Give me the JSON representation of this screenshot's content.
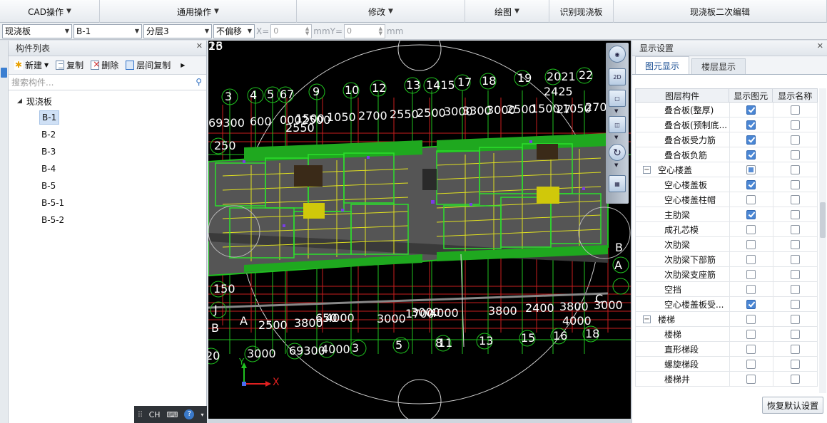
{
  "menubar": {
    "items": [
      {
        "label": "CAD操作",
        "caret": true
      },
      {
        "label": "通用操作",
        "caret": true
      },
      {
        "label": "修改",
        "caret": true
      },
      {
        "label": "绘图",
        "caret": true
      },
      {
        "label": "识别现浇板",
        "caret": false
      },
      {
        "label": "现浇板二次编辑",
        "caret": false
      }
    ]
  },
  "toolbar": {
    "type_select": "现浇板",
    "component_select": "B-1",
    "layer_select": "分层3",
    "offset_select": "不偏移",
    "x_label": "X=",
    "x_value": "0",
    "mm_y_label": "mmY=",
    "y_value": "0",
    "mm_label": "mm"
  },
  "component_list": {
    "title": "构件列表",
    "new_label": "新建",
    "copy_label": "复制",
    "delete_label": "删除",
    "floor_copy_label": "层间复制",
    "search_placeholder": "搜索构件...",
    "root_label": "现浇板",
    "items": [
      "B-1",
      "B-2",
      "B-3",
      "B-4",
      "B-5",
      "B-5-1",
      "B-5-2"
    ],
    "selected": "B-1"
  },
  "ime": {
    "lang": "CH",
    "help": "?"
  },
  "canvas": {
    "dimension_texts": [
      "3",
      "4",
      "5",
      "67",
      "9",
      "10",
      "12",
      "13",
      "1415",
      "17",
      "18",
      "19",
      "2021",
      "22",
      "2425",
      "27",
      "69300",
      "600",
      "0002500",
      "1500",
      "1050",
      "2700",
      "2550",
      "2500",
      "3000",
      "3300",
      "3000",
      "2500",
      "1500",
      "1050",
      "2700",
      "2550",
      "250",
      "150",
      "J",
      "B",
      "A",
      "C",
      "B",
      "A",
      "2500",
      "3800",
      "650",
      "4000",
      "3000",
      "1700",
      "3000",
      "4000",
      "3800",
      "2400",
      "3800",
      "4000",
      "3000",
      "3000",
      "69300",
      "4000",
      "3",
      "5",
      "8",
      "11",
      "13",
      "15",
      "16",
      "18",
      "20",
      "23",
      "26",
      "1"
    ],
    "axis_x": "X",
    "axis_y": "Y"
  },
  "display_settings": {
    "title": "显示设置",
    "tabs": [
      "图元显示",
      "楼层显示"
    ],
    "active_tab": "图元显示",
    "columns": [
      "图层构件",
      "显示图元",
      "显示名称"
    ],
    "rows": [
      {
        "label": "叠合板(整厚)",
        "type": "child",
        "show": "on",
        "name": "off"
      },
      {
        "label": "叠合板(预制底...",
        "type": "child",
        "show": "on",
        "name": "off"
      },
      {
        "label": "叠合板受力筋",
        "type": "child",
        "show": "on",
        "name": "off"
      },
      {
        "label": "叠合板负筋",
        "type": "child",
        "show": "on",
        "name": "off"
      },
      {
        "label": "空心楼盖",
        "type": "group",
        "show": "partial",
        "name": "off"
      },
      {
        "label": "空心楼盖板",
        "type": "child",
        "show": "on",
        "name": "off"
      },
      {
        "label": "空心楼盖柱帽",
        "type": "child",
        "show": "off",
        "name": "off"
      },
      {
        "label": "主肋梁",
        "type": "child",
        "show": "on",
        "name": "off"
      },
      {
        "label": "成孔芯模",
        "type": "child",
        "show": "off",
        "name": "off"
      },
      {
        "label": "次肋梁",
        "type": "child",
        "show": "off",
        "name": "off"
      },
      {
        "label": "次肋梁下部筋",
        "type": "child",
        "show": "off",
        "name": "off"
      },
      {
        "label": "次肋梁支座筋",
        "type": "child",
        "show": "off",
        "name": "off"
      },
      {
        "label": "空挡",
        "type": "child",
        "show": "off",
        "name": "off"
      },
      {
        "label": "空心楼盖板受...",
        "type": "child",
        "show": "on",
        "name": "off"
      },
      {
        "label": "楼梯",
        "type": "group",
        "show": "off",
        "name": "off"
      },
      {
        "label": "楼梯",
        "type": "child",
        "show": "off",
        "name": "off"
      },
      {
        "label": "直形梯段",
        "type": "child",
        "show": "off",
        "name": "off"
      },
      {
        "label": "螺旋梯段",
        "type": "child",
        "show": "off",
        "name": "off"
      },
      {
        "label": "楼梯井",
        "type": "child",
        "show": "off",
        "name": "off"
      }
    ],
    "restore_label": "恢复默认设置"
  },
  "colors": {
    "accent": "#3b7fd1",
    "cad_green": "#22cc22",
    "cad_yellow": "#e0e020",
    "cad_red": "#e02020",
    "cad_slab": "#555555"
  }
}
